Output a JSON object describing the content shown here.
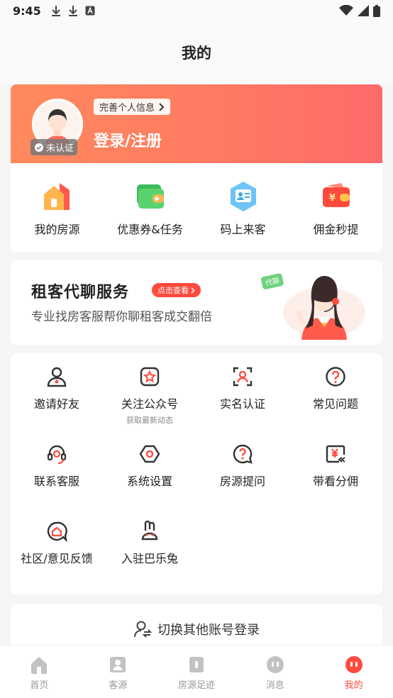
{
  "status": {
    "time": "9:45"
  },
  "header": {
    "title": "我的"
  },
  "profile": {
    "verify_badge": "未认证",
    "complete_info": "完善个人信息",
    "login": "登录/注册"
  },
  "quick_actions": [
    {
      "label": "我的房源",
      "icon": "house-icon"
    },
    {
      "label": "优惠券&任务",
      "icon": "wallet-icon"
    },
    {
      "label": "码上来客",
      "icon": "contact-card-icon"
    },
    {
      "label": "佣金秒提",
      "icon": "yen-wallet-icon"
    }
  ],
  "banner": {
    "title": "租客代聊服务",
    "tag": "点击查看",
    "subtitle": "专业找房客服帮你聊租客成交翻倍",
    "bubble": "代聊"
  },
  "tools": [
    {
      "label": "邀请好友",
      "icon": "invite-user-icon"
    },
    {
      "label": "关注公众号",
      "sub": "获取最新动态",
      "icon": "star-badge-icon"
    },
    {
      "label": "实名认证",
      "icon": "face-scan-icon"
    },
    {
      "label": "常见问题",
      "icon": "question-icon"
    },
    {
      "label": "联系客服",
      "icon": "headset-icon"
    },
    {
      "label": "系统设置",
      "icon": "settings-icon"
    },
    {
      "label": "房源提问",
      "icon": "question-bubble-icon"
    },
    {
      "label": "带看分佣",
      "icon": "commission-icon"
    },
    {
      "label": "社区/意见反馈",
      "icon": "feedback-icon"
    },
    {
      "label": "入驻巴乐兔",
      "icon": "rabbit-icon"
    }
  ],
  "switch_account": {
    "label": "切换其他账号登录"
  },
  "tabbar": [
    {
      "label": "首页",
      "icon": "home-icon"
    },
    {
      "label": "客源",
      "icon": "customer-icon"
    },
    {
      "label": "房源足迹",
      "icon": "footprint-icon"
    },
    {
      "label": "消息",
      "icon": "message-icon"
    },
    {
      "label": "我的",
      "icon": "me-icon",
      "active": true
    }
  ],
  "colors": {
    "accent": "#ff4b3e",
    "gradient_start": "#ff8a5c",
    "gradient_end": "#ff6a6a"
  }
}
